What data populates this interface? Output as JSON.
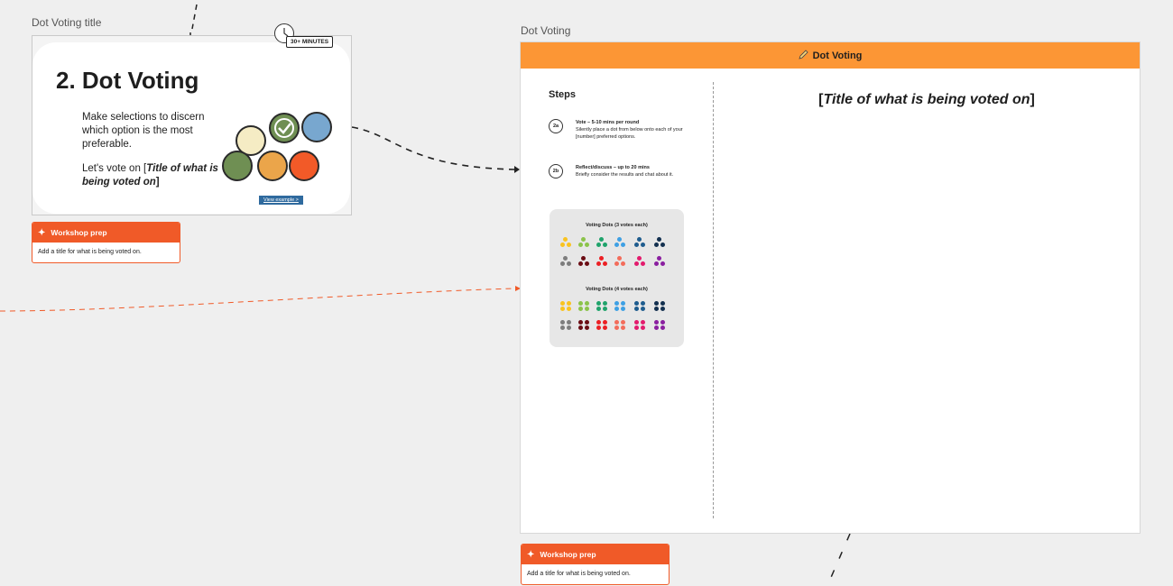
{
  "left_frame": {
    "label": "Dot Voting title",
    "title": "2. Dot Voting",
    "duration_badge": "30+ MINUTES",
    "description": "Make selections to discern which option is the most preferable.",
    "vote_prefix": "Let's vote on [",
    "vote_italic": "Title of what is being voted on",
    "vote_suffix": "]",
    "view_example": "View example >",
    "icons": [
      "clock-icon",
      "check-icon"
    ],
    "dot_colors": [
      "#f5ecc4",
      "#6f8f53",
      "#78a7cf",
      "#6f8f53",
      "#eba54a",
      "#f25a28"
    ]
  },
  "prep_note_left": {
    "title": "Workshop prep",
    "body": "Add a title for what is being voted on."
  },
  "board": {
    "label": "Dot Voting",
    "header": "Dot Voting",
    "steps_heading": "Steps",
    "steps": [
      {
        "id": "2a",
        "title": "Vote – 5-10 mins per round",
        "body": "Silently place a dot from below onto each of your [number] preferred options."
      },
      {
        "id": "2b",
        "title": "Reflect/discuss – up to 20 mins",
        "body": "Briefly consider the results and chat about it."
      }
    ],
    "voting_3_title": "Voting Dots (3 votes each)",
    "voting_4_title": "Voting Dots (4 votes each)",
    "dot_row1_colors": [
      "#f9c31f",
      "#8bc34a",
      "#1fa36b",
      "#3ea0e4",
      "#1e5c8e",
      "#13304f"
    ],
    "dot_row2_colors": [
      "#7d7d7d",
      "#6b0d14",
      "#ec2024",
      "#f36c5b",
      "#e31b6d",
      "#8a1fa0"
    ],
    "title_prefix": "[",
    "title_italic": "Title of what is being voted on",
    "title_suffix": "]"
  },
  "prep_note_bottom": {
    "title": "Workshop prep",
    "body": "Add a title for what is being voted on."
  },
  "colors": {
    "accent_orange": "#fc9635",
    "prep_orange": "#f05a28",
    "canvas": "#efefef"
  }
}
